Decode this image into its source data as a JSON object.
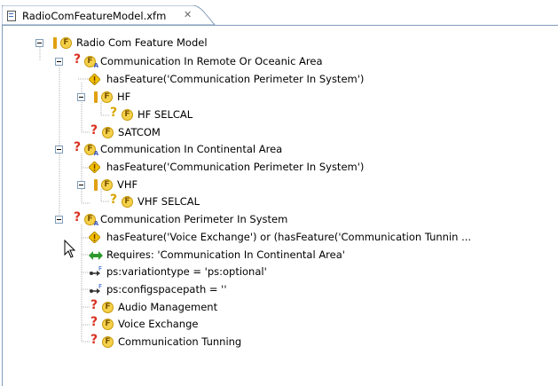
{
  "tab": {
    "title": "RadioComFeatureModel.xfm",
    "close": "✕"
  },
  "tree": {
    "root": "Radio Com Feature Model",
    "n1": "Communication In Remote Or Oceanic Area",
    "n1_constraint": "hasFeature('Communication Perimeter In System')",
    "n1_hf": "HF",
    "n1_hf_selcal": "HF SELCAL",
    "n1_satcom": "SATCOM",
    "n2": "Communication In Continental Area",
    "n2_constraint": "hasFeature('Communication Perimeter In System')",
    "n2_vhf": "VHF",
    "n2_vhf_selcal": "VHF SELCAL",
    "n3": "Communication Perimeter In System",
    "n3_constraint": "hasFeature('Voice Exchange') or (hasFeature('Communication Tunnin ...",
    "n3_requires": "Requires: 'Communication In Continental Area'",
    "n3_attr1": "ps:variationtype = 'ps:optional'",
    "n3_attr2": "ps:configspacepath = ''",
    "n3_audio": "Audio Management",
    "n3_voice": "Voice Exchange",
    "n3_tunning": "Communication Tunning"
  },
  "colors": {
    "tree_line": "#b0b0b0",
    "badge": "#f5d04a",
    "requires": "#2b9a2b"
  }
}
